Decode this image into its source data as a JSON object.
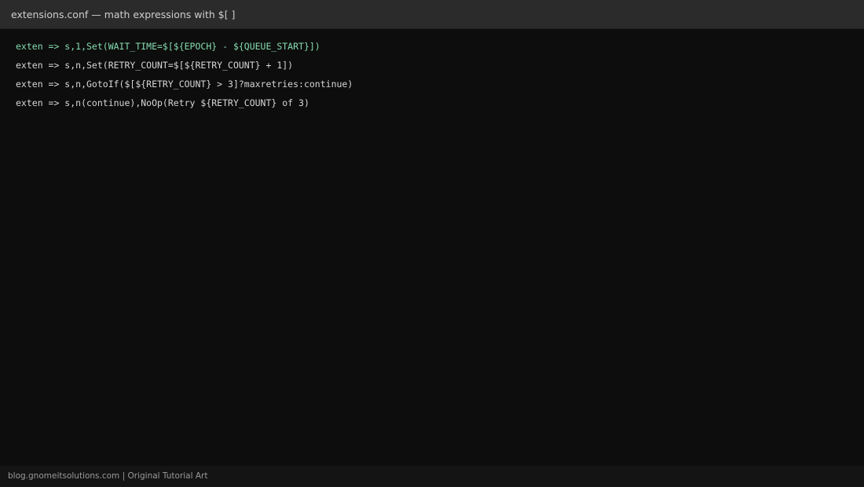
{
  "window": {
    "title": "extensions.conf — math expressions with $[ ]"
  },
  "editor": {
    "lines": [
      "exten => s,1,Set(WAIT_TIME=$[${EPOCH} - ${QUEUE_START}])",
      "exten => s,n,Set(RETRY_COUNT=$[${RETRY_COUNT} + 1])",
      "exten => s,n,GotoIf($[${RETRY_COUNT} > 3]?maxretries:continue)",
      "exten => s,n(continue),NoOp(Retry ${RETRY_COUNT} of 3)"
    ]
  },
  "footer": {
    "credit": "blog.gnomeitsolutions.com | Original Tutorial Art"
  },
  "colors": {
    "highlight_line": "#86dcb0",
    "code_text": "#d6d6d6",
    "background": "#0d0d0d",
    "titlebar": "#2b2b2b"
  }
}
